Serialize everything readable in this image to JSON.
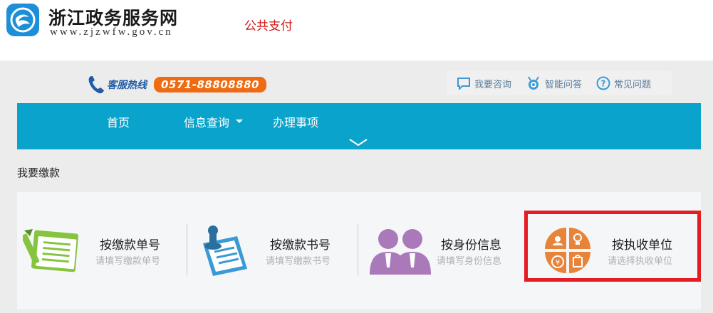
{
  "header": {
    "site_name": "浙江政务服务网",
    "site_url": "www.zjzwfw.gov.cn",
    "page_tag": "公共支付",
    "logo_icon": "zhejiang-logo-icon"
  },
  "hotline": {
    "label": "客服热线",
    "number": "0571-88808880",
    "icon": "phone-icon"
  },
  "top_links": [
    {
      "label": "我要咨询",
      "icon": "chat-bubble-icon"
    },
    {
      "label": "智能问答",
      "icon": "robot-icon"
    },
    {
      "label": "常见问题",
      "icon": "question-circle-icon"
    }
  ],
  "nav": {
    "items": [
      {
        "label": "首页"
      },
      {
        "label": "信息查询",
        "icon": "dropdown-caret-icon"
      },
      {
        "label": "办理事项"
      }
    ],
    "expand_icon": "chevron-down-icon"
  },
  "section": {
    "title": "我要缴款"
  },
  "options": [
    {
      "title": "按缴款单号",
      "subtitle": "请填写缴款单号",
      "icon": "document-pen-icon"
    },
    {
      "title": "按缴款书号",
      "subtitle": "请填写缴款书号",
      "icon": "document-stamp-icon"
    },
    {
      "title": "按身份信息",
      "subtitle": "请填写身份信息",
      "icon": "people-icon"
    },
    {
      "title": "按执收单位",
      "subtitle": "请选择执收单位",
      "icon": "organization-quadrant-icon"
    }
  ],
  "colors": {
    "nav_bg": "#0aa3cc",
    "hotline_badge": "#f06a12",
    "page_tag": "#d21a1a",
    "highlight_border": "#e31d24"
  }
}
